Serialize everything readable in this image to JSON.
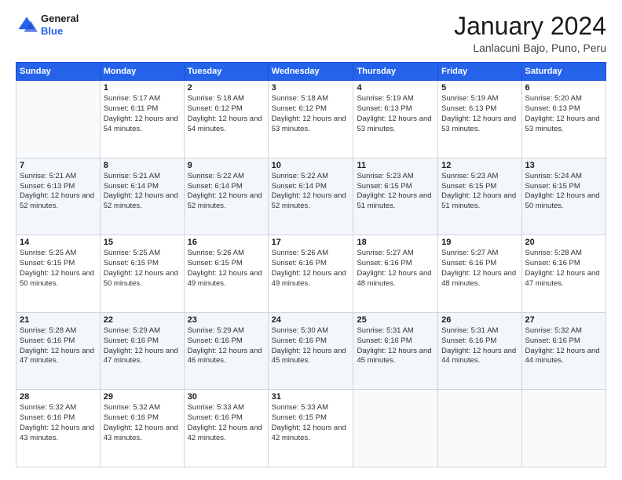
{
  "logo": {
    "general": "General",
    "blue": "Blue"
  },
  "title": "January 2024",
  "location": "Lanlacuni Bajo, Puno, Peru",
  "days_header": [
    "Sunday",
    "Monday",
    "Tuesday",
    "Wednesday",
    "Thursday",
    "Friday",
    "Saturday"
  ],
  "weeks": [
    [
      {
        "day": "",
        "text": ""
      },
      {
        "day": "1",
        "text": "Sunrise: 5:17 AM\nSunset: 6:11 PM\nDaylight: 12 hours\nand 54 minutes."
      },
      {
        "day": "2",
        "text": "Sunrise: 5:18 AM\nSunset: 6:12 PM\nDaylight: 12 hours\nand 54 minutes."
      },
      {
        "day": "3",
        "text": "Sunrise: 5:18 AM\nSunset: 6:12 PM\nDaylight: 12 hours\nand 53 minutes."
      },
      {
        "day": "4",
        "text": "Sunrise: 5:19 AM\nSunset: 6:13 PM\nDaylight: 12 hours\nand 53 minutes."
      },
      {
        "day": "5",
        "text": "Sunrise: 5:19 AM\nSunset: 6:13 PM\nDaylight: 12 hours\nand 53 minutes."
      },
      {
        "day": "6",
        "text": "Sunrise: 5:20 AM\nSunset: 6:13 PM\nDaylight: 12 hours\nand 53 minutes."
      }
    ],
    [
      {
        "day": "7",
        "text": "Sunrise: 5:21 AM\nSunset: 6:13 PM\nDaylight: 12 hours\nand 52 minutes."
      },
      {
        "day": "8",
        "text": "Sunrise: 5:21 AM\nSunset: 6:14 PM\nDaylight: 12 hours\nand 52 minutes."
      },
      {
        "day": "9",
        "text": "Sunrise: 5:22 AM\nSunset: 6:14 PM\nDaylight: 12 hours\nand 52 minutes."
      },
      {
        "day": "10",
        "text": "Sunrise: 5:22 AM\nSunset: 6:14 PM\nDaylight: 12 hours\nand 52 minutes."
      },
      {
        "day": "11",
        "text": "Sunrise: 5:23 AM\nSunset: 6:15 PM\nDaylight: 12 hours\nand 51 minutes."
      },
      {
        "day": "12",
        "text": "Sunrise: 5:23 AM\nSunset: 6:15 PM\nDaylight: 12 hours\nand 51 minutes."
      },
      {
        "day": "13",
        "text": "Sunrise: 5:24 AM\nSunset: 6:15 PM\nDaylight: 12 hours\nand 50 minutes."
      }
    ],
    [
      {
        "day": "14",
        "text": "Sunrise: 5:25 AM\nSunset: 6:15 PM\nDaylight: 12 hours\nand 50 minutes."
      },
      {
        "day": "15",
        "text": "Sunrise: 5:25 AM\nSunset: 6:15 PM\nDaylight: 12 hours\nand 50 minutes."
      },
      {
        "day": "16",
        "text": "Sunrise: 5:26 AM\nSunset: 6:15 PM\nDaylight: 12 hours\nand 49 minutes."
      },
      {
        "day": "17",
        "text": "Sunrise: 5:26 AM\nSunset: 6:16 PM\nDaylight: 12 hours\nand 49 minutes."
      },
      {
        "day": "18",
        "text": "Sunrise: 5:27 AM\nSunset: 6:16 PM\nDaylight: 12 hours\nand 48 minutes."
      },
      {
        "day": "19",
        "text": "Sunrise: 5:27 AM\nSunset: 6:16 PM\nDaylight: 12 hours\nand 48 minutes."
      },
      {
        "day": "20",
        "text": "Sunrise: 5:28 AM\nSunset: 6:16 PM\nDaylight: 12 hours\nand 47 minutes."
      }
    ],
    [
      {
        "day": "21",
        "text": "Sunrise: 5:28 AM\nSunset: 6:16 PM\nDaylight: 12 hours\nand 47 minutes."
      },
      {
        "day": "22",
        "text": "Sunrise: 5:29 AM\nSunset: 6:16 PM\nDaylight: 12 hours\nand 47 minutes."
      },
      {
        "day": "23",
        "text": "Sunrise: 5:29 AM\nSunset: 6:16 PM\nDaylight: 12 hours\nand 46 minutes."
      },
      {
        "day": "24",
        "text": "Sunrise: 5:30 AM\nSunset: 6:16 PM\nDaylight: 12 hours\nand 45 minutes."
      },
      {
        "day": "25",
        "text": "Sunrise: 5:31 AM\nSunset: 6:16 PM\nDaylight: 12 hours\nand 45 minutes."
      },
      {
        "day": "26",
        "text": "Sunrise: 5:31 AM\nSunset: 6:16 PM\nDaylight: 12 hours\nand 44 minutes."
      },
      {
        "day": "27",
        "text": "Sunrise: 5:32 AM\nSunset: 6:16 PM\nDaylight: 12 hours\nand 44 minutes."
      }
    ],
    [
      {
        "day": "28",
        "text": "Sunrise: 5:32 AM\nSunset: 6:16 PM\nDaylight: 12 hours\nand 43 minutes."
      },
      {
        "day": "29",
        "text": "Sunrise: 5:32 AM\nSunset: 6:16 PM\nDaylight: 12 hours\nand 43 minutes."
      },
      {
        "day": "30",
        "text": "Sunrise: 5:33 AM\nSunset: 6:16 PM\nDaylight: 12 hours\nand 42 minutes."
      },
      {
        "day": "31",
        "text": "Sunrise: 5:33 AM\nSunset: 6:15 PM\nDaylight: 12 hours\nand 42 minutes."
      },
      {
        "day": "",
        "text": ""
      },
      {
        "day": "",
        "text": ""
      },
      {
        "day": "",
        "text": ""
      }
    ]
  ]
}
